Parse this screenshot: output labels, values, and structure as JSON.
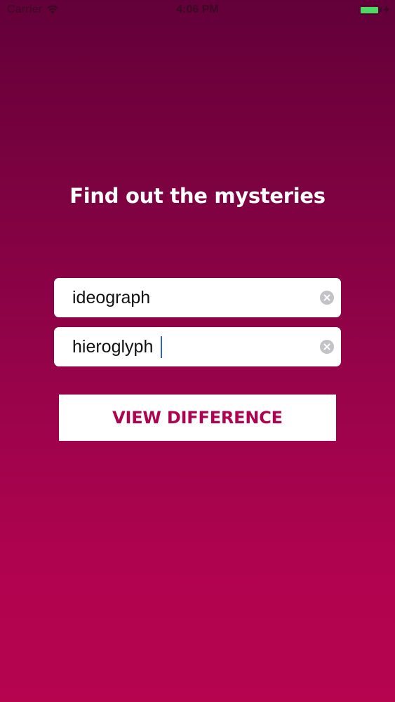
{
  "status_bar": {
    "carrier": "Carrier",
    "time": "4:06 PM",
    "icons": [
      "wifi-icon",
      "battery-icon",
      "charging-bolt-icon"
    ],
    "battery_level": 1.0,
    "battery_color": "#4cd964"
  },
  "main": {
    "title": "Find out the mysteries",
    "field_1_value": "ideograph",
    "field_2_value": "hieroglyph",
    "button_label": "VIEW DIFFERENCE"
  },
  "colors": {
    "background_top": "#63003a",
    "background_bottom": "#b6044f",
    "accent": "#b0034f",
    "cursor": "#2f5fd0",
    "clear_button": "#c2c2c7"
  }
}
